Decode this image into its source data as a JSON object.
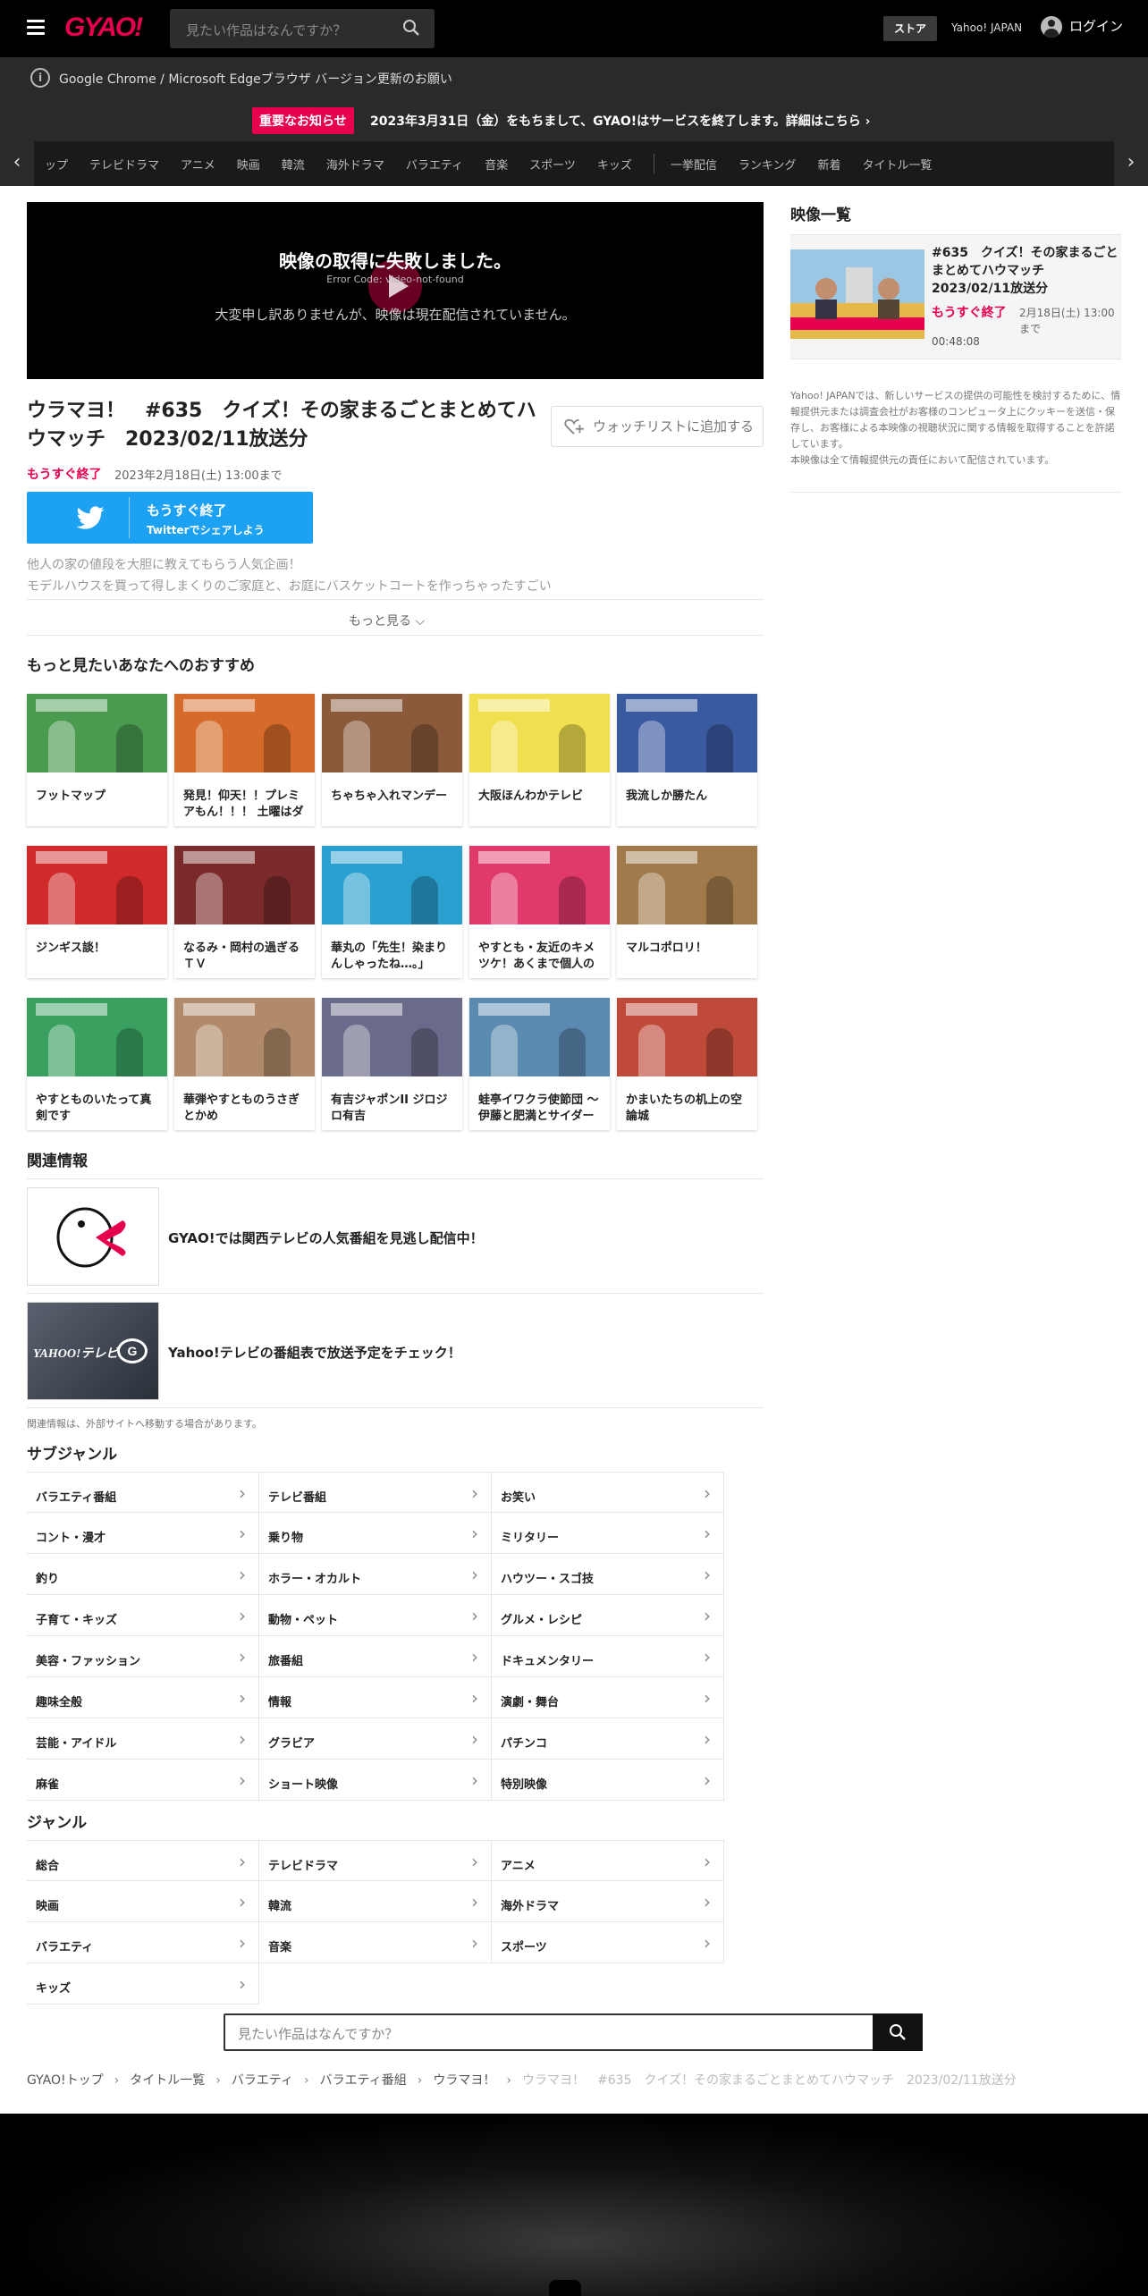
{
  "header": {
    "logo": "GYAO!",
    "search_placeholder": "見たい作品はなんですか？",
    "store": "ストア",
    "yahoo": "Yahoo! JAPAN",
    "login": "ログイン"
  },
  "notices": {
    "browser": "Google Chrome / Microsoft Edgeブラウザ バージョン更新のお願い",
    "badge": "重要なお知らせ",
    "important": "2023年3月31日（金）をもちまして、GYAO!はサービスを終了します。詳細はこちら ›"
  },
  "nav": {
    "items": [
      "ップ",
      "テレビドラマ",
      "アニメ",
      "映画",
      "韓流",
      "海外ドラマ",
      "バラエティ",
      "音楽",
      "スポーツ",
      "キッズ",
      "一挙配信",
      "ランキング",
      "新着",
      "タイトル一覧"
    ]
  },
  "player": {
    "error_title": "映像の取得に失敗しました。",
    "error_code": "Error Code: video-not-found",
    "error_message": "大変申し訳ありませんが、映像は現在配信されていません。"
  },
  "episode": {
    "title": "ウラマヨ！　#635　クイズ！その家まるごとまとめてハウマッチ　2023/02/11放送分",
    "watchlist": "ウォッチリストに追加する",
    "soon": "もうすぐ終了",
    "until": "2023年2月18日(土) 13:00まで",
    "twitter_main": "もうすぐ終了",
    "twitter_sub": "Twitterでシェアしよう",
    "description": "他人の家の値段を大胆に教えてもらう人気企画！\nモデルハウスを買って得しまくりのご家庭と、お庭にバスケットコートを作っちゃったすごい",
    "more": "もっと見る ⌵"
  },
  "recommend": {
    "heading": "もっと見たいあなたへのおすすめ",
    "items": [
      {
        "title": "フットマップ",
        "color": "#4a9a50"
      },
      {
        "title": "発見！仰天！！プレミアもん！！！ 土曜はダ",
        "color": "#d66a2a"
      },
      {
        "title": "ちゃちゃ入れマンデー",
        "color": "#8a5a3a"
      },
      {
        "title": "大阪ほんわかテレビ",
        "color": "#f0e050"
      },
      {
        "title": "我流しか勝たん",
        "color": "#3a5aa0"
      },
      {
        "title": "ジンギス談！",
        "color": "#d02a2a"
      },
      {
        "title": "なるみ・岡村の過ぎるＴＶ",
        "color": "#7a2a2a"
      },
      {
        "title": "華丸の「先生！染まりんしゃったね…。」",
        "color": "#2aa0d0"
      },
      {
        "title": "やすとも・友近のキメツケ！あくまで個人の",
        "color": "#e03a6a"
      },
      {
        "title": "マルコポロリ！",
        "color": "#a07a4a"
      },
      {
        "title": "やすとものいたって真剣です",
        "color": "#3aa060"
      },
      {
        "title": "華弾やすとものうさぎとかめ",
        "color": "#b08a6a"
      },
      {
        "title": "有吉ジャポンII ジロジロ有吉",
        "color": "#6a6a8a"
      },
      {
        "title": "蛙亭イワクラ使節団 ～伊藤と肥満とサイダー",
        "color": "#5a8ab0"
      },
      {
        "title": "かまいたちの机上の空論城",
        "color": "#c04a3a"
      }
    ]
  },
  "related": {
    "heading": "関連情報",
    "items": [
      "GYAO!では関西テレビの人気番組を見逃し配信中！",
      "Yahoo!テレビの番組表で放送予定をチェック！"
    ],
    "yahoo_logo": "YAHOO!テレビ",
    "gガイド": "G",
    "note": "関連情報は、外部サイトへ移動する場合があります。"
  },
  "subgenre": {
    "heading": "サブジャンル",
    "items": [
      "バラエティ番組",
      "テレビ番組",
      "お笑い",
      "コント・漫才",
      "乗り物",
      "ミリタリー",
      "釣り",
      "ホラー・オカルト",
      "ハウツー・スゴ技",
      "子育て・キッズ",
      "動物・ペット",
      "グルメ・レシピ",
      "美容・ファッション",
      "旅番組",
      "ドキュメンタリー",
      "趣味全般",
      "情報",
      "演劇・舞台",
      "芸能・アイドル",
      "グラビア",
      "パチンコ",
      "麻雀",
      "ショート映像",
      "特別映像"
    ]
  },
  "genre": {
    "heading": "ジャンル",
    "items": [
      "総合",
      "テレビドラマ",
      "アニメ",
      "映画",
      "韓流",
      "海外ドラマ",
      "バラエティ",
      "音楽",
      "スポーツ",
      "キッズ"
    ]
  },
  "bottom_search": {
    "placeholder": "見たい作品はなんですか？"
  },
  "breadcrumb": [
    "GYAO!トップ",
    "タイトル一覧",
    "バラエティ",
    "バラエティ番組",
    "ウラマヨ！",
    "ウラマヨ！　#635　クイズ！その家まるごとまとめてハウマッチ　2023/02/11放送分"
  ],
  "sidebar": {
    "heading": "映像一覧",
    "item_title": "#635　クイズ！その家まるごとまとめてハウマッチ　2023/02/11放送分",
    "item_soon": "もうすぐ終了",
    "item_until": "2月18日(土) 13:00まで",
    "item_duration": "00:48:08",
    "note": "Yahoo! JAPANでは、新しいサービスの提供の可能性を検討するために、情報提供元または調査会社がお客様のコンピュータ上にクッキーを送信・保存し、お客様による本映像の視聴状況に関する情報を取得することを許諾しています。\n本映像は全て情報提供元の責任において配信されています。"
  },
  "colors": {
    "brand": "#e6004f",
    "twitter": "#1da1f2"
  }
}
